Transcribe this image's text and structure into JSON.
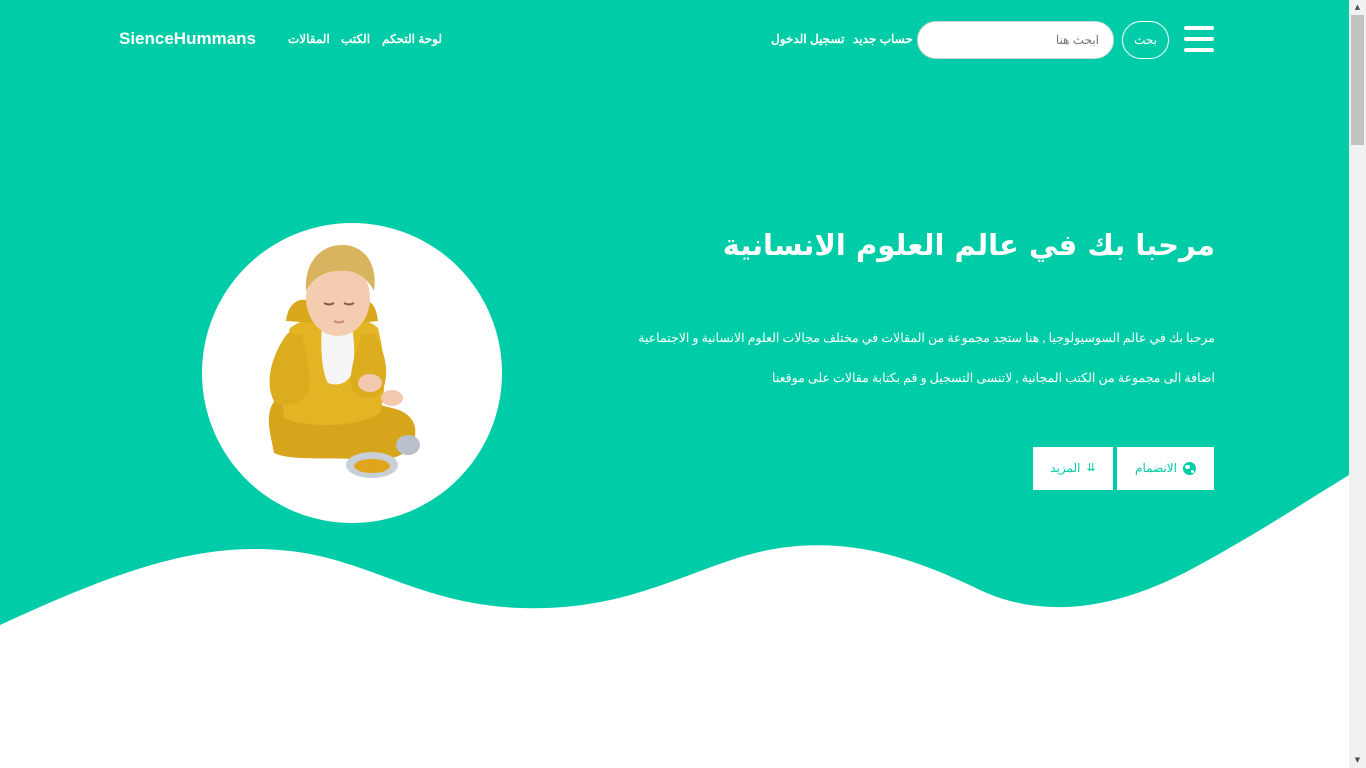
{
  "colors": {
    "brand": "#00cca8",
    "text_on_brand": "#ffffff",
    "background": "#ffffff"
  },
  "navbar": {
    "brand": "SienceHummans",
    "links": [
      "لوحة التحكم",
      "الكتب",
      "المقالات"
    ],
    "auth_links": [
      "حساب جديد",
      "تسجيل الدخول"
    ],
    "search_placeholder": "ابحث هنا",
    "search_button": "بحث",
    "menu_icon": "hamburger-menu-icon"
  },
  "hero": {
    "title": "مرحبا بك في عالم العلوم الانسانية",
    "text": "مرحبا بك في عالم السوسيولوجيا , هنا ستجد مجموعة من المقالات في مختلف مجالات العلوم الانسانية و الاجتماعية اضافة الى مجموعة من الكتب المجانية , لاتنسى التسجيل و قم بكتابة مقالات على موقعنا",
    "join_button": "الانضمام",
    "join_icon": "globe-icon",
    "more_button": "المزيد",
    "more_icon": "chevron-double-down-icon",
    "image": "child-photo"
  }
}
